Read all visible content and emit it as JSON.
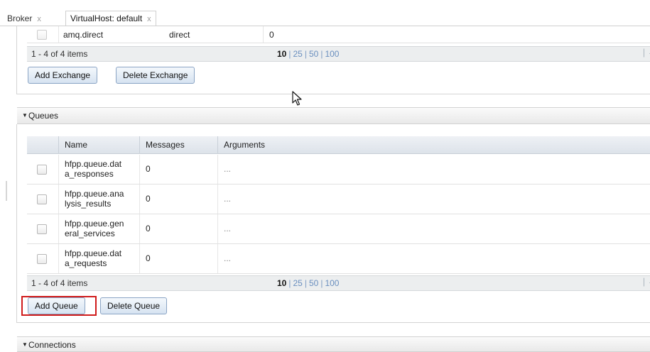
{
  "tabs": [
    {
      "label": "Broker",
      "close": "x"
    },
    {
      "label": "VirtualHost: default",
      "close": "x"
    }
  ],
  "exchanges": {
    "row": {
      "name": "amq.direct",
      "type": "direct",
      "bindings": "0"
    },
    "pager": {
      "info": "1 - 4 of 4 items",
      "sizes": [
        "10",
        "25",
        "50",
        "100"
      ],
      "current": "10"
    },
    "add_label": "Add Exchange",
    "delete_label": "Delete Exchange"
  },
  "queues": {
    "title": "Queues",
    "columns": {
      "name": "Name",
      "messages": "Messages",
      "arguments": "Arguments"
    },
    "rows": [
      {
        "name_line1": "hfpp.queue.dat",
        "name_line2": "a_responses",
        "messages": "0",
        "arguments": "..."
      },
      {
        "name_line1": "hfpp.queue.ana",
        "name_line2": "lysis_results",
        "messages": "0",
        "arguments": "..."
      },
      {
        "name_line1": "hfpp.queue.gen",
        "name_line2": "eral_services",
        "messages": "0",
        "arguments": "..."
      },
      {
        "name_line1": "hfpp.queue.dat",
        "name_line2": "a_requests",
        "messages": "0",
        "arguments": "..."
      }
    ],
    "pager": {
      "info": "1 - 4 of 4 items",
      "sizes": [
        "10",
        "25",
        "50",
        "100"
      ],
      "current": "10"
    },
    "add_label": "Add Queue",
    "delete_label": "Delete Queue"
  },
  "connections": {
    "title": "Connections"
  },
  "colors": {
    "highlight": "#d01b1b",
    "link": "#6a8fbf"
  }
}
